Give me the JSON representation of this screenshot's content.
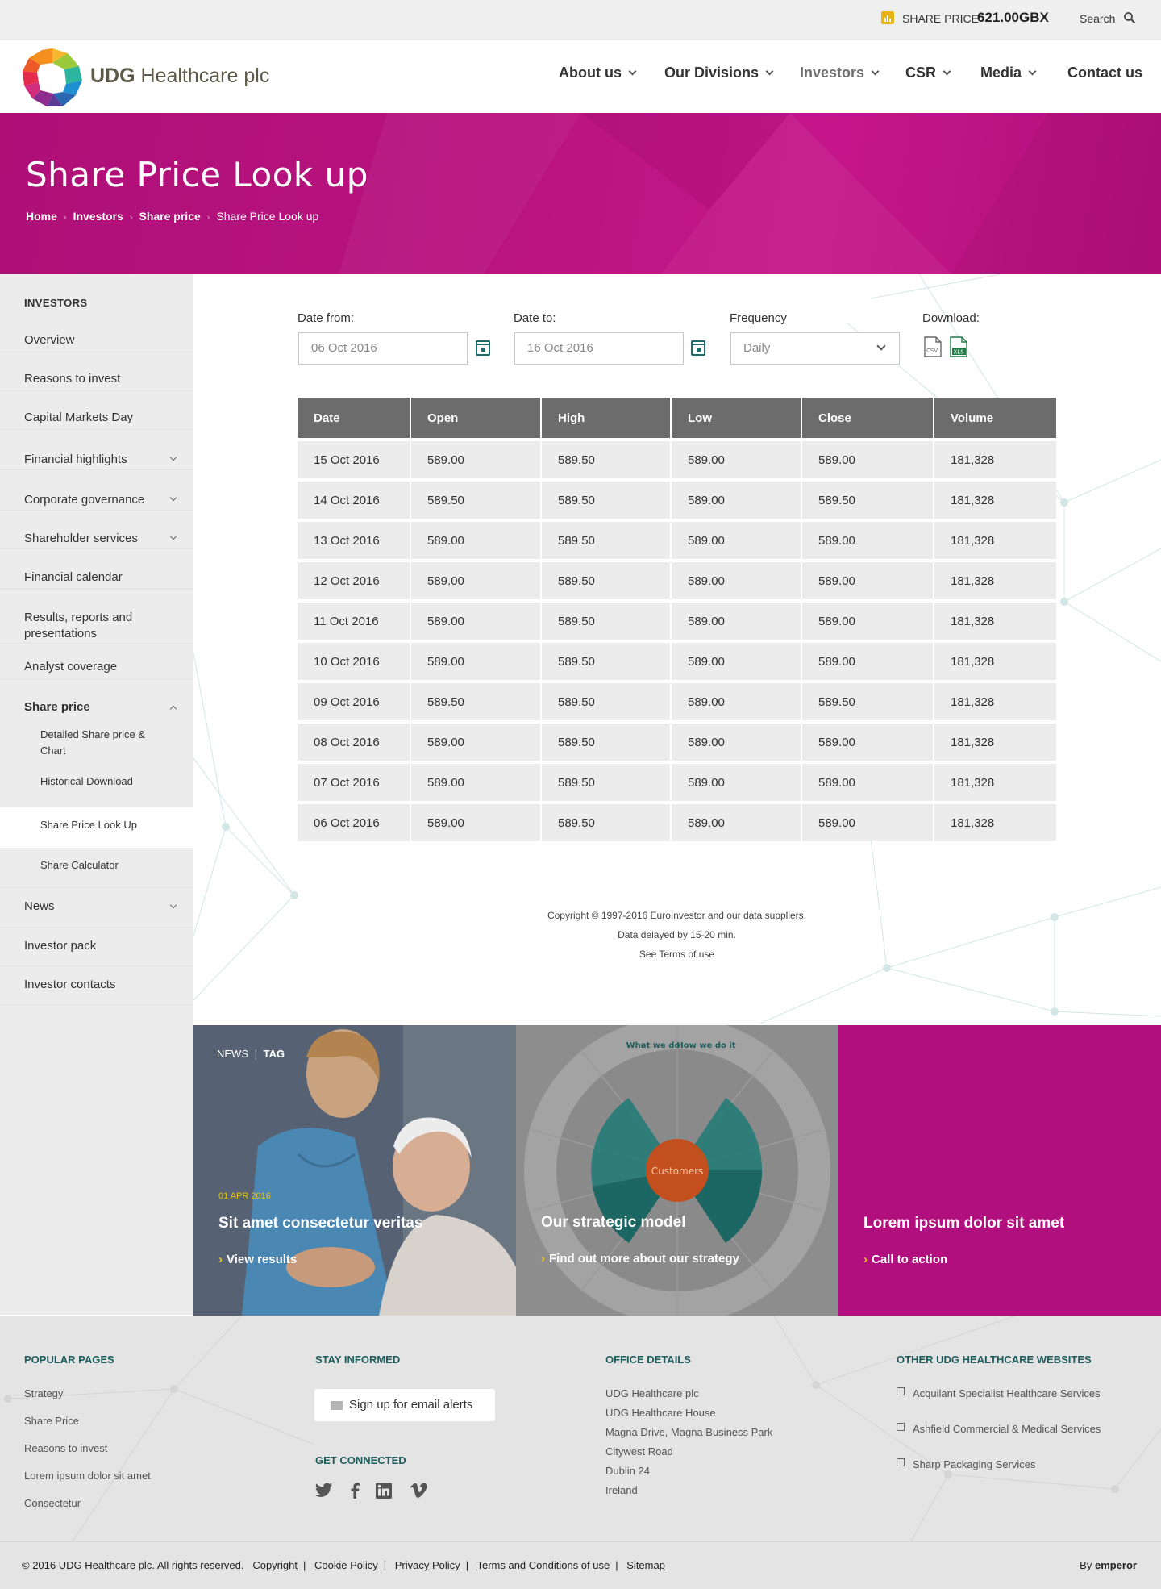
{
  "topbar": {
    "share_label": "SHARE PRICE",
    "share_value": "621.00GBX",
    "search_label": "Search"
  },
  "brand": {
    "name_bold": "UDG",
    "name_rest": "Healthcare plc"
  },
  "nav": {
    "items": [
      "About us",
      "Our Divisions",
      "Investors",
      "CSR",
      "Media",
      "Contact us"
    ],
    "active": "Investors"
  },
  "hero": {
    "title": "Share Price Look up",
    "breadcrumb": [
      "Home",
      "Investors",
      "Share price",
      "Share Price Look up"
    ]
  },
  "sidebar": {
    "title": "INVESTORS",
    "items": [
      "Overview",
      "Reasons to invest",
      "Capital Markets Day",
      "Financial highlights",
      "Corporate governance",
      "Shareholder services",
      "Financial calendar",
      "Results, reports and presentations",
      "Analyst coverage",
      "Share price",
      "News",
      "Investor pack",
      "Investor contacts"
    ],
    "sub": [
      "Detailed Share price & Chart",
      "Historical Download",
      "Share Price Look Up",
      "Share Calculator"
    ]
  },
  "filters": {
    "date_from_label": "Date from:",
    "date_from": "06 Oct 2016",
    "date_to_label": "Date to:",
    "date_to": "16 Oct 2016",
    "frequency_label": "Frequency",
    "frequency": "Daily",
    "download_label": "Download:",
    "csv": "CSV",
    "xls": "XLS"
  },
  "table": {
    "headers": [
      "Date",
      "Open",
      "High",
      "Low",
      "Close",
      "Volume"
    ],
    "rows": [
      [
        "15 Oct 2016",
        "589.00",
        "589.50",
        "589.00",
        "589.00",
        "181,328"
      ],
      [
        "14 Oct 2016",
        "589.50",
        "589.50",
        "589.00",
        "589.50",
        "181,328"
      ],
      [
        "13 Oct 2016",
        "589.00",
        "589.50",
        "589.00",
        "589.00",
        "181,328"
      ],
      [
        "12 Oct 2016",
        "589.00",
        "589.50",
        "589.00",
        "589.00",
        "181,328"
      ],
      [
        "11 Oct 2016",
        "589.00",
        "589.50",
        "589.00",
        "589.00",
        "181,328"
      ],
      [
        "10 Oct 2016",
        "589.00",
        "589.50",
        "589.00",
        "589.00",
        "181,328"
      ],
      [
        "09 Oct 2016",
        "589.50",
        "589.50",
        "589.00",
        "589.50",
        "181,328"
      ],
      [
        "08 Oct 2016",
        "589.00",
        "589.50",
        "589.00",
        "589.00",
        "181,328"
      ],
      [
        "07 Oct 2016",
        "589.00",
        "589.50",
        "589.00",
        "589.00",
        "181,328"
      ],
      [
        "06 Oct 2016",
        "589.00",
        "589.50",
        "589.00",
        "589.00",
        "181,328"
      ]
    ]
  },
  "notes": {
    "copyright": "Copyright © 1997-2016 EuroInvestor and our data suppliers.",
    "delay": "Data delayed by 15-20 min.",
    "terms": "See Terms of use"
  },
  "tiles": [
    {
      "tag1": "NEWS",
      "tag2": "TAG",
      "date": "01 APR 2016",
      "title": "Sit amet consectetur veritas",
      "cta": "View results"
    },
    {
      "title": "Our strategic model",
      "cta": "Find out more about our strategy",
      "center": "Customers",
      "hdr_left": "What we do",
      "hdr_right": "How we do it"
    },
    {
      "title": "Lorem ipsum dolor sit amet",
      "cta": "Call to action"
    }
  ],
  "footer": {
    "popular_title": "POPULAR PAGES",
    "popular": [
      "Strategy",
      "Share Price",
      "Reasons to invest",
      "Lorem ipsum dolor sit amet",
      "Consectetur"
    ],
    "stay_title": "STAY INFORMED",
    "email_button": "Sign up for email alerts",
    "connected_title": "GET CONNECTED",
    "office_title": "OFFICE DETAILS",
    "office": [
      "UDG Healthcare plc",
      "UDG Healthcare House",
      "Magna Drive, Magna Business Park",
      "Citywest Road",
      "Dublin 24",
      "Ireland"
    ],
    "other_title": "OTHER UDG HEALTHCARE WEBSITES",
    "other": [
      "Acquilant Specialist Healthcare Services",
      "Ashfield Commercial & Medical Services",
      "Sharp Packaging Services"
    ]
  },
  "bottom": {
    "copyright": "© 2016 UDG Healthcare plc. All rights reserved.",
    "links": [
      "Copyright",
      "Cookie Policy",
      "Privacy Policy",
      "Terms and Conditions of use",
      "Sitemap"
    ],
    "by": "By",
    "agency": "emperor"
  }
}
